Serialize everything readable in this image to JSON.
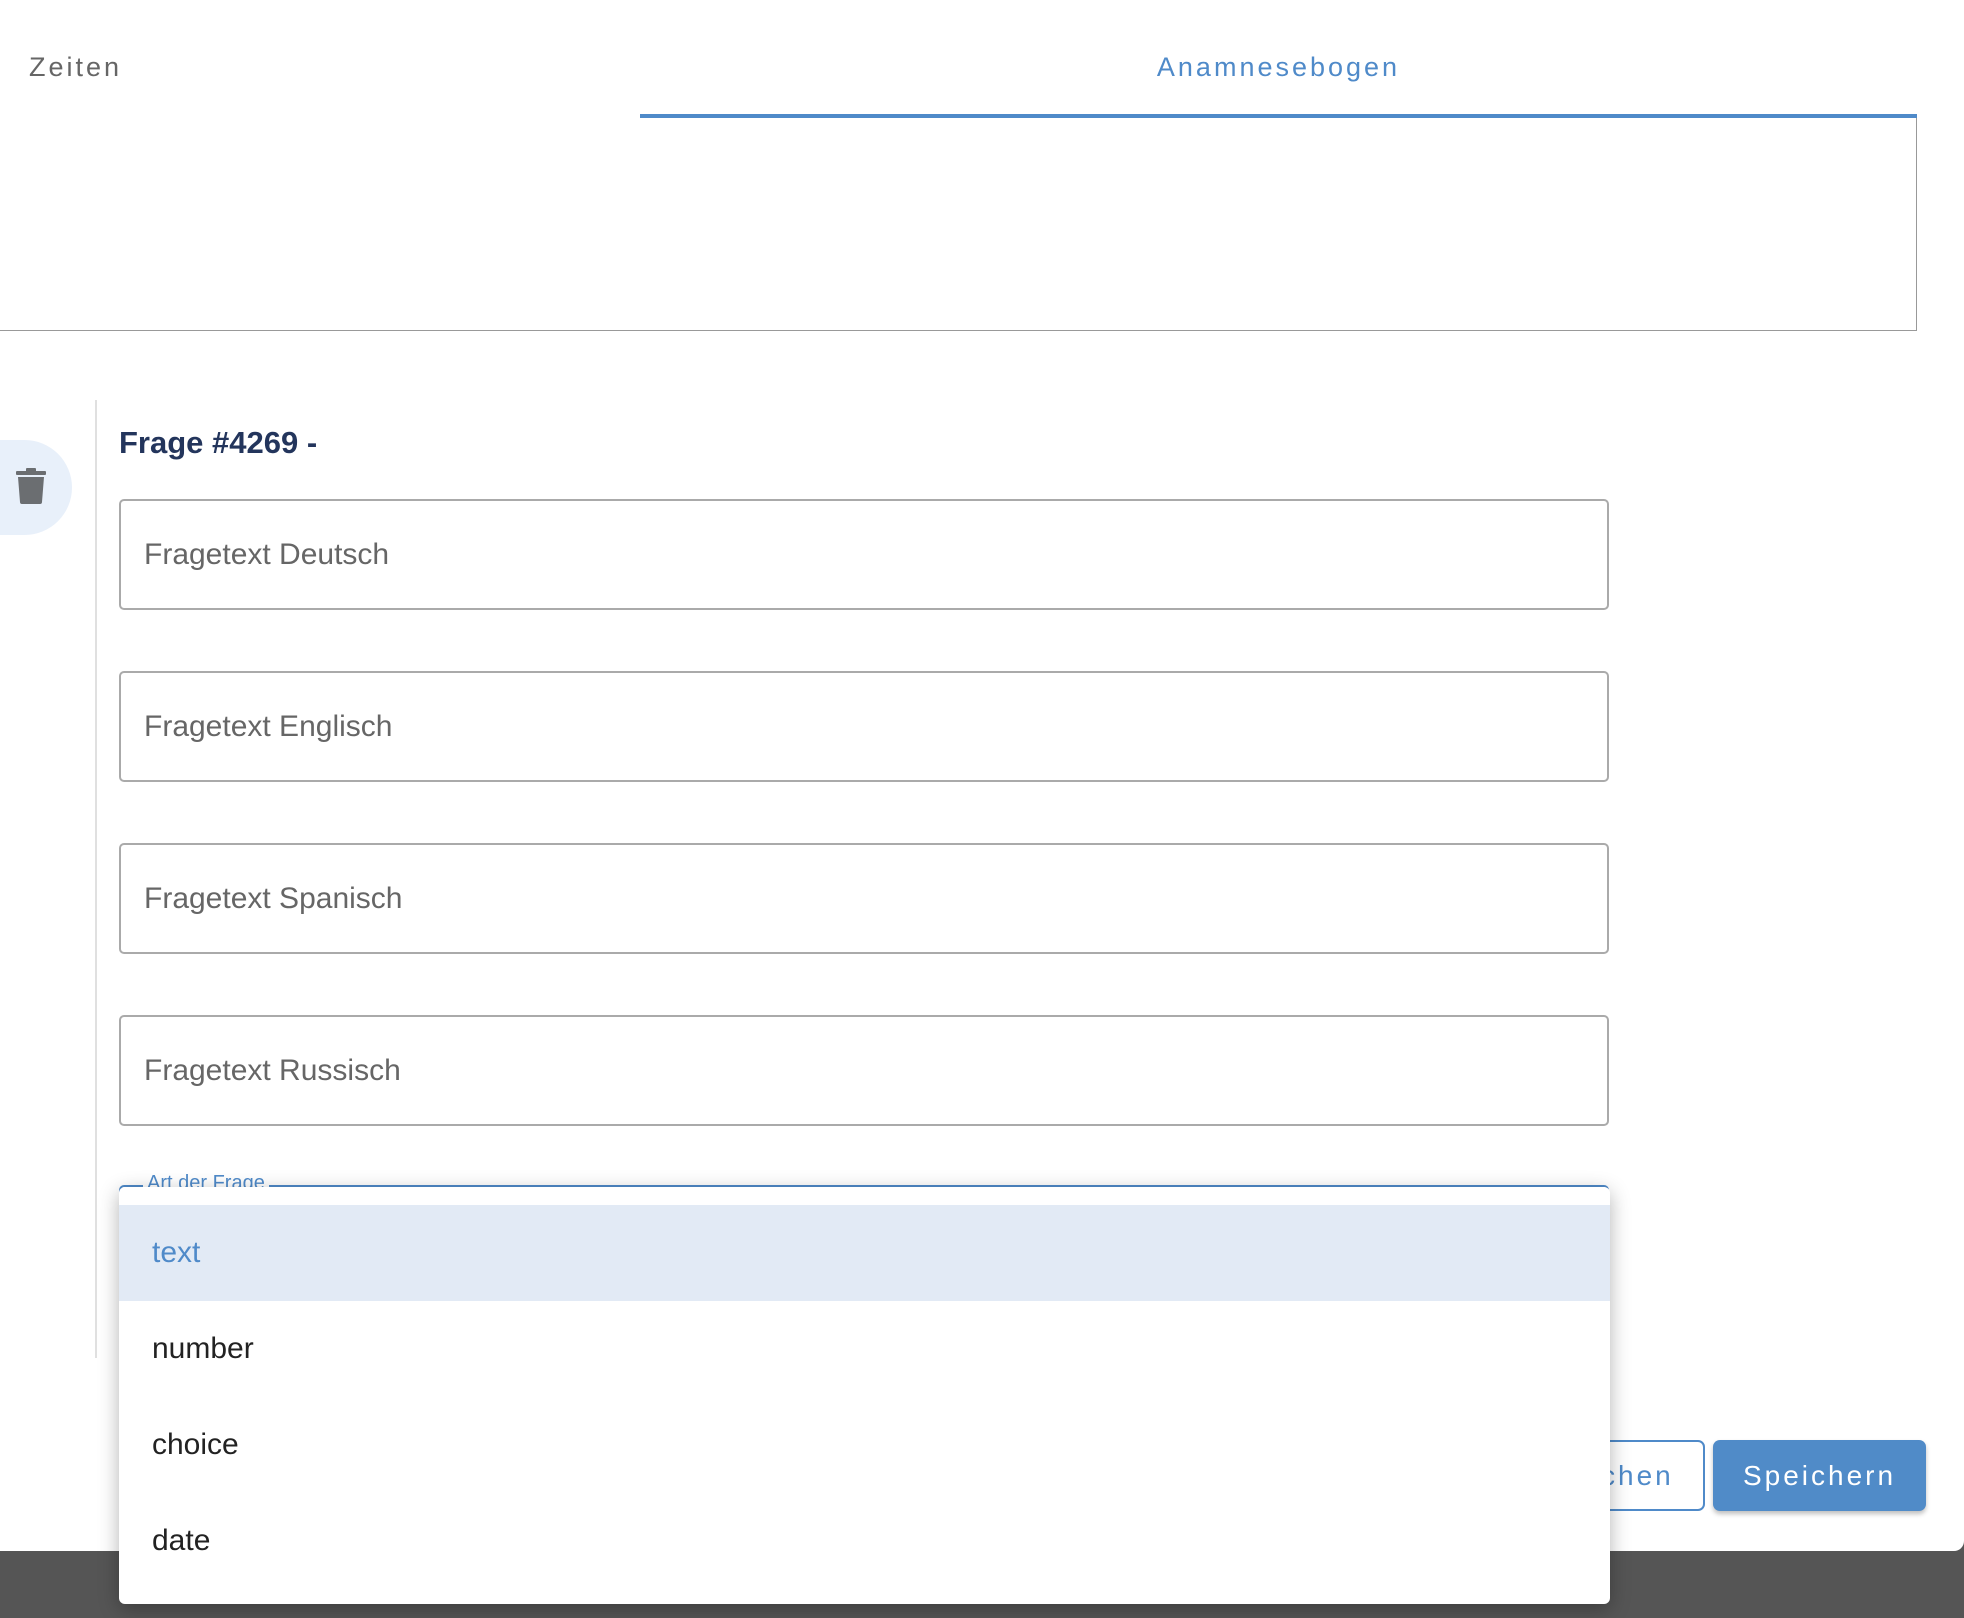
{
  "tabs": [
    {
      "label": "Zeiten",
      "active": false
    },
    {
      "label": "Anamnesebogen",
      "active": true
    }
  ],
  "question": {
    "title": "Frage #4269 -",
    "fields": [
      {
        "placeholder": "Fragetext Deutsch"
      },
      {
        "placeholder": "Fragetext Englisch"
      },
      {
        "placeholder": "Fragetext Spanisch"
      },
      {
        "placeholder": "Fragetext Russisch"
      }
    ],
    "type_select": {
      "label": "Art der Frage",
      "options": [
        "text",
        "number",
        "choice",
        "date"
      ],
      "selected": "text"
    }
  },
  "buttons": {
    "cancel": "Abbrechen",
    "save": "Speichern"
  },
  "colors": {
    "accent": "#4f8ac9",
    "title": "#23355c",
    "highlight": "#e2eaf5"
  }
}
